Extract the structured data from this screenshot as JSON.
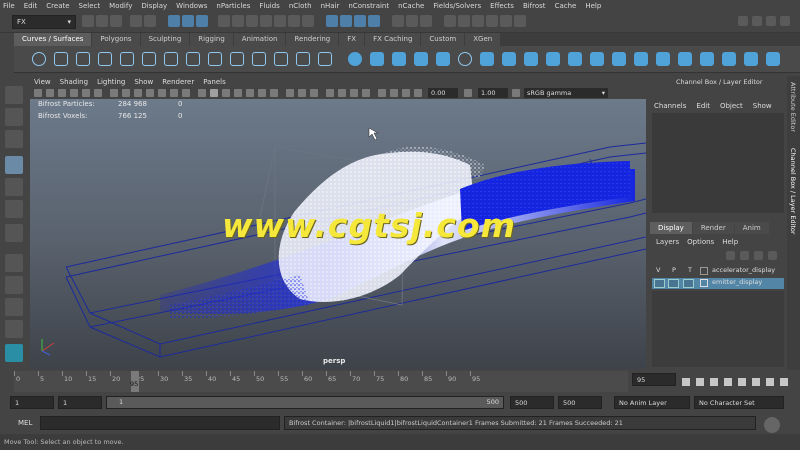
{
  "menubar": [
    "File",
    "Edit",
    "Create",
    "Select",
    "Modify",
    "Display",
    "Windows",
    "nParticles",
    "Fluids",
    "nCloth",
    "nHair",
    "nConstraint",
    "nCache",
    "Fields/Solvers",
    "Effects",
    "Bifrost",
    "Cache",
    "Help"
  ],
  "status_line": {
    "mode": "FX"
  },
  "shelf_tabs": [
    "Curves / Surfaces",
    "Polygons",
    "Sculpting",
    "Rigging",
    "Animation",
    "Rendering",
    "FX",
    "FX Caching",
    "Custom",
    "XGen"
  ],
  "viewport_menu": [
    "View",
    "Shading",
    "Lighting",
    "Show",
    "Renderer",
    "Panels"
  ],
  "viewport_toolbar": {
    "exposure": "0.00",
    "gamma": "1.00",
    "color_space": "sRGB gamma"
  },
  "hud": {
    "rows": [
      {
        "label": "Bifrost Particles:",
        "value": "284 968",
        "extra": "0"
      },
      {
        "label": "Bifrost Voxels:",
        "value": "766 125",
        "extra": "0"
      }
    ],
    "camera": "persp"
  },
  "watermark": "www.cgtsj.com",
  "channel_box": {
    "title": "Channel Box / Layer Editor",
    "menu": [
      "Channels",
      "Edit",
      "Object",
      "Show"
    ]
  },
  "layer_editor": {
    "tabs": [
      "Display",
      "Render",
      "Anim"
    ],
    "menu": [
      "Layers",
      "Options",
      "Help"
    ],
    "columns": [
      "V",
      "P",
      "T"
    ],
    "layers": [
      "accelerator_display",
      "emitter_display"
    ]
  },
  "side_tabs": [
    "Attribute Editor",
    "Channel Box / Layer Editor"
  ],
  "time_slider": {
    "ticks": [
      "0",
      "5",
      "10",
      "15",
      "20",
      "25",
      "30",
      "35",
      "40",
      "45",
      "50",
      "55",
      "60",
      "65",
      "70",
      "75",
      "80",
      "85",
      "90",
      "95"
    ],
    "current_frame": "95",
    "current_frame_field": "95"
  },
  "range_slider": {
    "start": "1",
    "playback_start": "1",
    "range_low": "1",
    "range_high": "500",
    "playback_end": "500",
    "end": "500",
    "anim_layer": "No Anim Layer",
    "character_set": "No Character Set"
  },
  "command_line": {
    "label": "MEL",
    "result": "Bifrost Container: |bifrostLiquid1|bifrostLiquidContainer1 Frames Submitted: 21 Frames Succeeded: 21"
  },
  "help_line": "Move Tool: Select an object to move.",
  "colors": {
    "ui_bg": "#444444",
    "selection": "#5285a6",
    "particles_blue": "#1f2cd8",
    "particles_white": "#f2f4ff",
    "watermark": "#f5e83a",
    "wire": "#1c2a9a"
  }
}
